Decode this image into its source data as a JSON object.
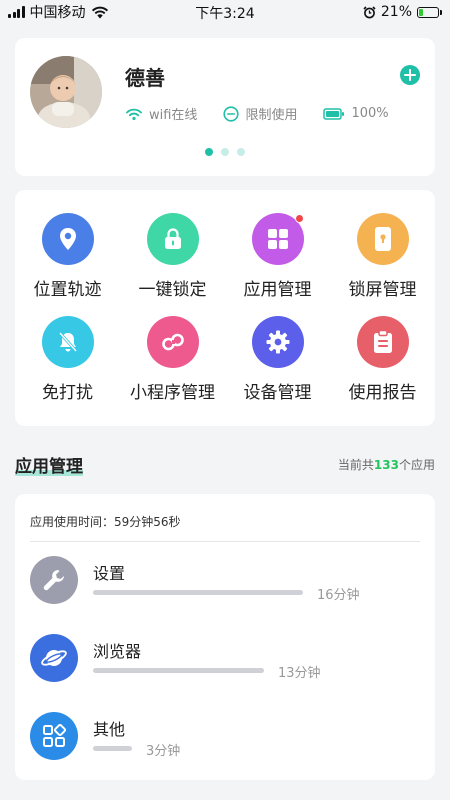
{
  "status_bar": {
    "carrier": "中国移动",
    "time": "下午3:24",
    "battery_percent": "21%",
    "battery_level": 0.21,
    "icons": [
      "signal-icon",
      "wifi-icon",
      "alarm-icon",
      "battery-icon"
    ]
  },
  "profile": {
    "name": "德善",
    "wifi_status": "wifi在线",
    "restriction_status": "限制使用",
    "battery": "100%",
    "page_count": 3,
    "active_page": 0,
    "accent_color": "#1fbfa8"
  },
  "features": [
    {
      "label": "位置轨迹",
      "icon": "location-pin-icon",
      "color": "#4a7fe8"
    },
    {
      "label": "一键锁定",
      "icon": "lock-icon",
      "color": "#3ed7a5"
    },
    {
      "label": "应用管理",
      "icon": "apps-grid-icon",
      "color": "#c25ce8",
      "badge": true
    },
    {
      "label": "锁屏管理",
      "icon": "phone-lock-icon",
      "color": "#f5b251"
    },
    {
      "label": "免打扰",
      "icon": "bell-off-icon",
      "color": "#37c8e6"
    },
    {
      "label": "小程序管理",
      "icon": "mini-program-icon",
      "color": "#ee5a8e"
    },
    {
      "label": "设备管理",
      "icon": "gear-icon",
      "color": "#5c5fea"
    },
    {
      "label": "使用报告",
      "icon": "clipboard-icon",
      "color": "#e65f69"
    }
  ],
  "app_section": {
    "title": "应用管理",
    "count_prefix": "当前共",
    "count": "133",
    "count_suffix": "个应用",
    "usage_total": "应用使用时间：59分钟56秒",
    "apps": [
      {
        "name": "设置",
        "duration": "16分钟",
        "minutes": 16,
        "icon": "wrench-icon",
        "color": "#9c9eae"
      },
      {
        "name": "浏览器",
        "duration": "13分钟",
        "minutes": 13,
        "icon": "planet-icon",
        "color": "#3b6fe0"
      },
      {
        "name": "其他",
        "duration": "3分钟",
        "minutes": 3,
        "icon": "apps-other-icon",
        "color": "#2b8ce8"
      }
    ]
  }
}
